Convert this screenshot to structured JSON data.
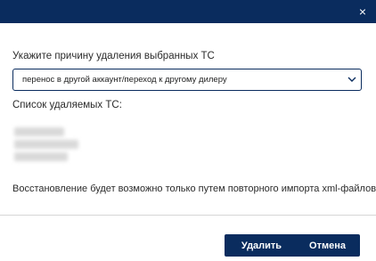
{
  "dialog": {
    "close_glyph": "×",
    "header_color": "#0a2c5e"
  },
  "reason": {
    "label": "Укажите причину удаления выбранных ТС",
    "selected": "перенос в другой аккаунт/переход к другому дилеру"
  },
  "vehicles": {
    "title": "Список удаляемых ТС:"
  },
  "notice": "Восстановление будет возможно только путем повторного импорта xml-файлов.",
  "buttons": {
    "delete": "Удалить",
    "cancel": "Отмена"
  }
}
